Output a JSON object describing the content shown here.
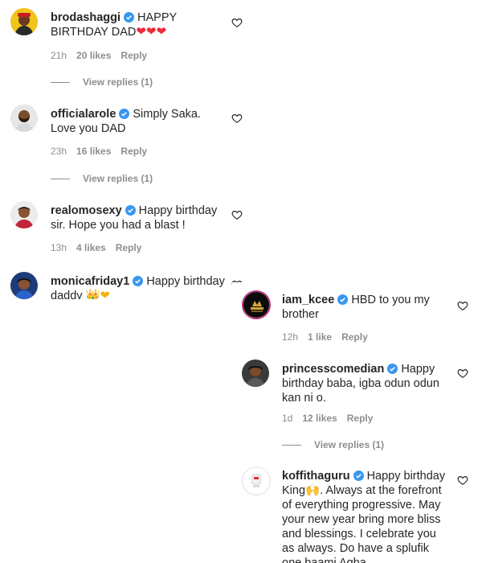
{
  "left_comments": [
    {
      "username": "brodashaggi",
      "text": "HAPPY BIRTHDAY DAD",
      "emoji": "❤❤❤",
      "time": "21h",
      "likes": "20 likes",
      "reply": "Reply",
      "view_replies": "View replies (1)"
    },
    {
      "username": "officialarole",
      "text": "Simply Saka. Love you DAD",
      "time": "23h",
      "likes": "16 likes",
      "reply": "Reply",
      "view_replies": "View replies (1)"
    },
    {
      "username": "realomosexy",
      "text": "Happy birthday sir. Hope you had a blast !",
      "time": "13h",
      "likes": "4 likes",
      "reply": "Reply"
    },
    {
      "username": "monicafriday1",
      "text": "Happy birthday daddy",
      "emoji": "👑❤"
    }
  ],
  "right_comments": [
    {
      "username": "iam_kcee",
      "text": "HBD to you my brother",
      "time": "12h",
      "likes": "1 like",
      "reply": "Reply"
    },
    {
      "username": "princesscomedian",
      "text": "Happy birthday baba, igba odun odun kan ni o.",
      "time": "1d",
      "likes": "12 likes",
      "reply": "Reply",
      "view_replies": "View replies (1)"
    },
    {
      "username": "koffithaguru",
      "text_before_emoji": "Happy birthday King",
      "emoji": "🙌",
      "text_after_emoji": ". Always at the forefront of everything progressive. May your new year bring more bliss and blessings. I celebrate you as always. Do have a splufik one baami Agba"
    }
  ],
  "icons": {
    "verified": "verified-badge-icon",
    "like": "heart-outline-icon"
  },
  "colors": {
    "verified": "#3897f0",
    "muted": "#8e8e8e",
    "text": "#262626",
    "heart_emoji": "#ed2a3a"
  }
}
